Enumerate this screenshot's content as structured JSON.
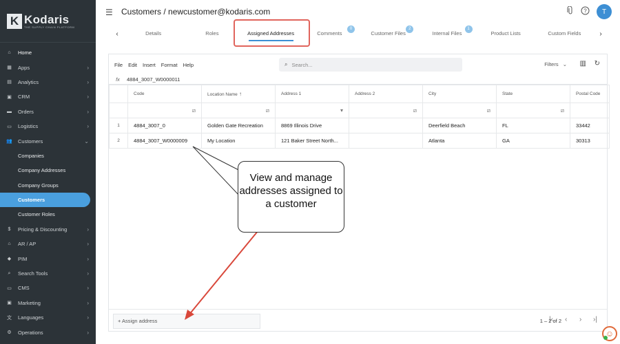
{
  "brand": {
    "logo_mark": "K",
    "name": "Kodaris",
    "tagline": "THE SUPPLY CHAIN PLATFORM"
  },
  "sidebar": {
    "items": [
      {
        "label": "Home",
        "icon": "home-icon",
        "glyph": "⌂",
        "chevron": ""
      },
      {
        "label": "Apps",
        "icon": "apps-icon",
        "glyph": "▦",
        "chevron": "›"
      },
      {
        "label": "Analytics",
        "icon": "analytics-icon",
        "glyph": "▤",
        "chevron": "›"
      },
      {
        "label": "CRM",
        "icon": "crm-icon",
        "glyph": "▣",
        "chevron": "›"
      },
      {
        "label": "Orders",
        "icon": "orders-icon",
        "glyph": "▬",
        "chevron": "›"
      },
      {
        "label": "Logistics",
        "icon": "logistics-icon",
        "glyph": "▭",
        "chevron": "›"
      },
      {
        "label": "Customers",
        "icon": "customers-icon",
        "glyph": "👥",
        "chevron": "⌄"
      },
      {
        "label": "Companies",
        "sub": true
      },
      {
        "label": "Company Addresses",
        "sub": true
      },
      {
        "label": "Company Groups",
        "sub": true
      },
      {
        "label": "Customers",
        "sub": true,
        "active": true
      },
      {
        "label": "Customer Roles",
        "sub": true
      },
      {
        "label": "Pricing & Discounting",
        "icon": "dollar-icon",
        "glyph": "$",
        "chevron": "›"
      },
      {
        "label": "AR / AP",
        "icon": "bank-icon",
        "glyph": "⌂",
        "chevron": "›"
      },
      {
        "label": "PIM",
        "icon": "tag-icon",
        "glyph": "◆",
        "chevron": "›"
      },
      {
        "label": "Search Tools",
        "icon": "search-tools-icon",
        "glyph": "⌕",
        "chevron": "›"
      },
      {
        "label": "CMS",
        "icon": "cms-icon",
        "glyph": "▭",
        "chevron": "›"
      },
      {
        "label": "Marketing",
        "icon": "marketing-icon",
        "glyph": "▣",
        "chevron": "›"
      },
      {
        "label": "Languages",
        "icon": "languages-icon",
        "glyph": "文",
        "chevron": "›"
      },
      {
        "label": "Operations",
        "icon": "operations-icon",
        "glyph": "⚙",
        "chevron": "›"
      }
    ]
  },
  "header": {
    "title": "Customers / newcustomer@kodaris.com",
    "avatar": "T"
  },
  "tabs": [
    {
      "label": "Details"
    },
    {
      "label": "Roles"
    },
    {
      "label": "Assigned Addresses",
      "active": true
    },
    {
      "label": "Comments",
      "badge": "0"
    },
    {
      "label": "Customer Files",
      "badge": "2"
    },
    {
      "label": "Internal Files",
      "badge": "1"
    },
    {
      "label": "Product Lists"
    },
    {
      "label": "Custom Fields"
    }
  ],
  "toolbar": {
    "menu": [
      "File",
      "Edit",
      "Insert",
      "Format",
      "Help"
    ],
    "search_placeholder": "Search...",
    "filters_label": "Filters"
  },
  "formula_bar": {
    "fx": "fx",
    "value": "4884_3007_W0000011"
  },
  "table": {
    "columns": [
      "Code",
      "Location Name",
      "Address 1",
      "Address 2",
      "City",
      "State",
      "Postal Code"
    ],
    "rows": [
      {
        "num": "1",
        "cells": [
          "4884_3007_0",
          "Golden Gate Recreation",
          "8869 Illinois Drive",
          "",
          "Deerfield Beach",
          "FL",
          "33442"
        ]
      },
      {
        "num": "2",
        "cells": [
          "4884_3007_W0000009",
          "My Location",
          "121 Baker Street North...",
          "",
          "Atlanta",
          "GA",
          "30313"
        ]
      }
    ]
  },
  "footer": {
    "assign_label": "+ Assign address",
    "pager_text": "1 – 2 of 2"
  },
  "callout": {
    "text": "View and manage addresses assigned to a customer"
  },
  "colors": {
    "accent": "#3d8fd4",
    "highlight": "#e0645c",
    "sidebar": "#2c3338",
    "arrow": "#d9483b"
  }
}
